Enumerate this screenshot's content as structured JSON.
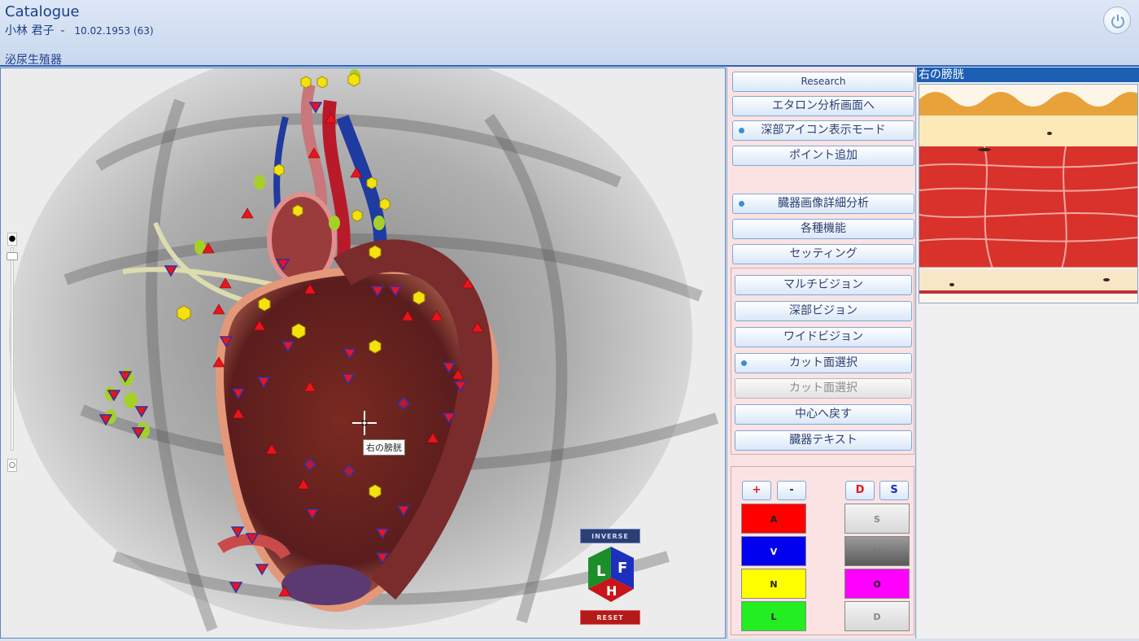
{
  "header": {
    "app_title": "Catalogue",
    "patient_name": "小林 君子",
    "separator": "-",
    "patient_dob": "10.02.1953 (63)",
    "section": "泌尿生殖器"
  },
  "viewport": {
    "hover_label": "右の膀胱",
    "zoom_top_glyph": "●",
    "zoom_bottom_glyph": "○",
    "cube": {
      "inverse": "INVERSE",
      "reset": "RESET",
      "face_l": "L",
      "face_f": "F",
      "face_h": "H"
    }
  },
  "menu": {
    "research": "Research",
    "etalon": "エタロン分析画面へ",
    "deep_icon_mode": "深部アイコン表示モード",
    "add_point": "ポイント追加",
    "organ_image_analysis": "臓器画像詳細分析",
    "functions": "各種機能",
    "settings": "セッティング",
    "multi_vision": "マルチビジョン",
    "deep_vision": "深部ビジョン",
    "wide_vision": "ワイドビジョン",
    "cut_plane_select": "カット面選択",
    "cut_plane_select_disabled": "カット面選択",
    "back_to_center": "中心へ戻す",
    "organ_text": "臓器テキスト"
  },
  "layer_controls": {
    "plus": "+",
    "minus": "-",
    "d": "D",
    "s": "S",
    "a": "A",
    "v": "V",
    "n": "N",
    "l": "L",
    "s2": "S",
    "m": "M",
    "o": "O",
    "d2": "D"
  },
  "colors": {
    "a": "#ff0000",
    "v": "#0000ee",
    "n": "#ffff00",
    "l": "#22ee22",
    "o": "#ff00ff",
    "accent": "#1d5fb5"
  },
  "tissue_panel": {
    "title": "右の膀胱"
  }
}
